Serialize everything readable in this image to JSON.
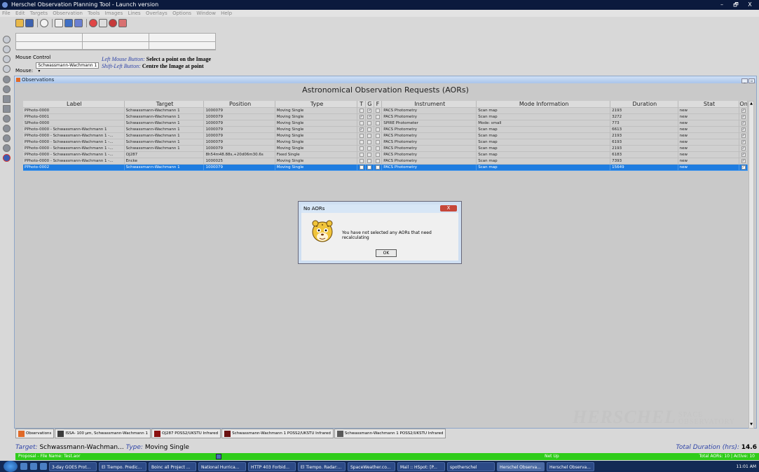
{
  "window": {
    "title": "Herschel Observation Planning Tool - Launch version",
    "controls": [
      "–",
      "🗗",
      "X"
    ]
  },
  "menu": [
    "File",
    "Edit",
    "Targets",
    "Observation",
    "Tools",
    "Images",
    "Lines",
    "Overlays",
    "Options",
    "Window",
    "Help"
  ],
  "mouse_control": {
    "label": "Mouse Control",
    "mode_label": "Mouse:",
    "mode_value": "Schwassmann-Wachmann 1"
  },
  "hints": {
    "left_key": "Left Mouse Button:",
    "left_text": "Select a point on the Image",
    "shift_key": "Shift-Left Button:",
    "shift_text": "Centre the Image at point"
  },
  "panel": {
    "title": "Observations",
    "table_title": "Astronomical Observation Requests (AORs)"
  },
  "columns": [
    "Label",
    "Target",
    "Position",
    "Type",
    "T",
    "G",
    "F",
    "Instrument",
    "Mode Information",
    "Duration",
    "Stat",
    "On"
  ],
  "rows": [
    {
      "label": "PPhoto-0000",
      "target": "Schwassmann-Wachmann 1",
      "position": "1000079",
      "type": "Moving Single",
      "t": "",
      "g": "✓",
      "f": "",
      "instrument": "PACS Photometry",
      "mode": "Scan map",
      "duration": "2193",
      "stat": "new",
      "on": "✓"
    },
    {
      "label": "PPhoto-0001",
      "target": "Schwassmann-Wachmann 1",
      "position": "1000079",
      "type": "Moving Single",
      "t": "✓",
      "g": "✓",
      "f": "",
      "instrument": "PACS Photometry",
      "mode": "Scan map",
      "duration": "3272",
      "stat": "new",
      "on": "✓"
    },
    {
      "label": "SPhoto-0000",
      "target": "Schwassmann-Wachmann 1",
      "position": "1000079",
      "type": "Moving Single",
      "t": "",
      "g": "",
      "f": "",
      "instrument": "SPIRE Photometer",
      "mode": "Mode: small",
      "duration": "773",
      "stat": "new",
      "on": "✓"
    },
    {
      "label": "PPhoto-0000 - Schwassmann-Wachmann 1",
      "target": "Schwassmann-Wachmann 1",
      "position": "1000079",
      "type": "Moving Single",
      "t": "✓",
      "g": "",
      "f": "",
      "instrument": "PACS Photometry",
      "mode": "Scan map",
      "duration": "6613",
      "stat": "new",
      "on": "✓"
    },
    {
      "label": "PPhoto-0000 - Schwassmann-Wachmann 1 -...",
      "target": "Schwassmann-Wachmann 1",
      "position": "1000079",
      "type": "Moving Single",
      "t": "",
      "g": "",
      "f": "",
      "instrument": "PACS Photometry",
      "mode": "Scan map",
      "duration": "2193",
      "stat": "new",
      "on": "✓"
    },
    {
      "label": "PPhoto-0000 - Schwassmann-Wachmann 1 -...",
      "target": "Schwassmann-Wachmann 1",
      "position": "1000079",
      "type": "Moving Single",
      "t": "",
      "g": "",
      "f": "",
      "instrument": "PACS Photometry",
      "mode": "Scan map",
      "duration": "6193",
      "stat": "new",
      "on": "✓"
    },
    {
      "label": "PPhoto-0000 - Schwassmann-Wachmann 1 -...",
      "target": "Schwassmann-Wachmann 1",
      "position": "1000079",
      "type": "Moving Single",
      "t": "",
      "g": "",
      "f": "",
      "instrument": "PACS Photometry",
      "mode": "Scan map",
      "duration": "2193",
      "stat": "new",
      "on": "✓"
    },
    {
      "label": "PPhoto-0000 - Schwassmann-Wachmann 1 -...",
      "target": "OJ287",
      "position": "8h54m48.88s,+20d06m30.6s",
      "type": "Fixed Single",
      "t": "",
      "g": "",
      "f": "",
      "instrument": "PACS Photometry",
      "mode": "Scan map",
      "duration": "6183",
      "stat": "new",
      "on": "✓"
    },
    {
      "label": "PPhoto-0000 - Schwassmann-Wachmann 1 -...",
      "target": "Encke",
      "position": "1000025",
      "type": "Moving Single",
      "t": "",
      "g": "",
      "f": "",
      "instrument": "PACS Photometry",
      "mode": "Scan map",
      "duration": "7393",
      "stat": "new",
      "on": "✓"
    },
    {
      "label": "PPhoto-0002",
      "target": "Schwassmann-Wachmann 1",
      "position": "1000079",
      "type": "Moving Single",
      "t": "",
      "g": "",
      "f": "",
      "instrument": "PACS Photometry",
      "mode": "Scan map",
      "duration": "15649",
      "stat": "new",
      "on": "✓",
      "selected": true
    }
  ],
  "watermark": {
    "main": "HERSCHEL",
    "sub1": "SPACE",
    "sub2": "OBSERVATORY"
  },
  "dialog": {
    "title": "No AORs",
    "close": "X",
    "message": "You have not selected any AORs that need recalculating",
    "ok": "OK"
  },
  "bottom_tabs": [
    {
      "label": "Observations",
      "color": "#e06a28"
    },
    {
      "label": "ISSA- 100 µm,  Schwassmann-Wachmann 1",
      "color": "#3c3c3c"
    },
    {
      "label": "OJ287  POSS2/UKSTU Infrared",
      "color": "#8a1010"
    },
    {
      "label": "Schwassmann-Wachmann 1  POSS2/UKSTU Infrared",
      "color": "#6a1010"
    },
    {
      "label": "Schwassmann-Wachmann 1  POSS2/UKSTU Infrared",
      "color": "#5a5a5a"
    }
  ],
  "status": {
    "target_key": "Target:",
    "target_val": "Schwassmann-Wachman...",
    "type_key": "Type:",
    "type_val": "Moving Single",
    "total_key": "Total Duration (hrs):",
    "total_val": "14.6"
  },
  "greenbar": {
    "proposal": "Proposal - File Name: Test.aor",
    "net": "Net Up",
    "totals": "Total AORs: 10  |  Active: 10"
  },
  "taskbar": {
    "tasks": [
      "3-day GOES Prot...",
      "El Tiempo. Predic...",
      "Boinc all Project ...",
      "National Hurrica...",
      "HTTP 403 Forbid...",
      "El Tiempo. Radar:...",
      "SpaceWeather.co...",
      "Mail :: HSpot: [P...",
      "spotherschel",
      "Herschel Observa...",
      "Herschel Observa..."
    ],
    "clock": "11:01 AM"
  }
}
